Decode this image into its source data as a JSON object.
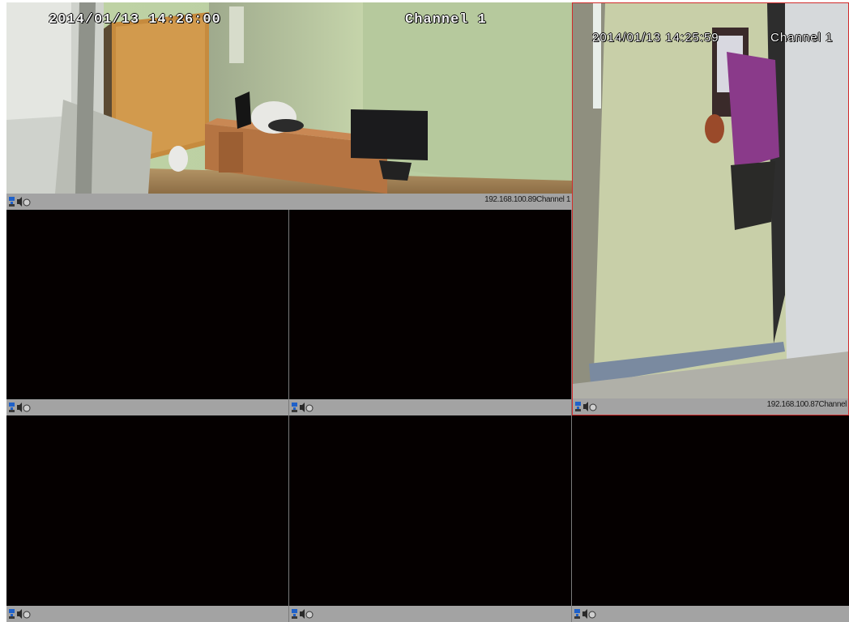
{
  "tiles": {
    "main": {
      "osd_date": "2014/01/13 14:26:00",
      "osd_channel": "Channel 1",
      "status_label": "192.168.100.89Channel 1"
    },
    "right": {
      "osd_date": "2014/01/13 14:25:59",
      "osd_channel": "Channel 1",
      "status_label": "192.168.100.87Channel"
    },
    "r2a": {
      "status_label": ""
    },
    "r2b": {
      "status_label": ""
    },
    "r3a": {
      "status_label": ""
    },
    "r3b": {
      "status_label": ""
    },
    "r3c": {
      "status_label": ""
    }
  },
  "colors": {
    "selected_border": "#d12b2b",
    "status_bar": "#a3a3a3",
    "empty_video": "#050000"
  },
  "icons": [
    "network-icon",
    "audio-icon",
    "record-icon"
  ]
}
